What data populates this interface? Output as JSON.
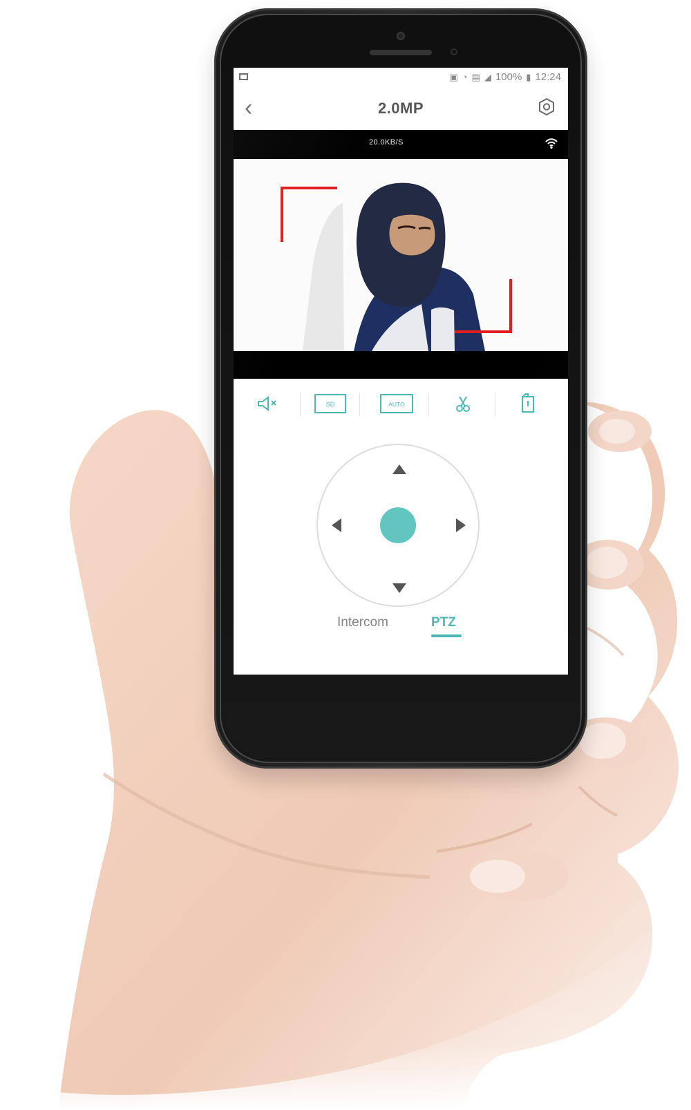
{
  "status_bar": {
    "battery": "100%",
    "time": "12:24"
  },
  "header": {
    "title": "2.0MP",
    "back_icon": "chevron-left-icon",
    "settings_icon": "settings-icon"
  },
  "stream": {
    "speed": "20.0KB/S",
    "wifi_icon": "wifi-icon"
  },
  "controls": {
    "mute_icon": "mute-icon",
    "sd_label": "SD",
    "auto_label": "AUTO",
    "snapshot_icon": "scissors-icon",
    "fullscreen_icon": "screen-rotate-icon"
  },
  "tabs": [
    {
      "label": "Intercom"
    },
    {
      "label": "PTZ"
    }
  ],
  "colors": {
    "accent": "#4db8b3",
    "alert": "#e31d1d",
    "dark": "#111111"
  }
}
